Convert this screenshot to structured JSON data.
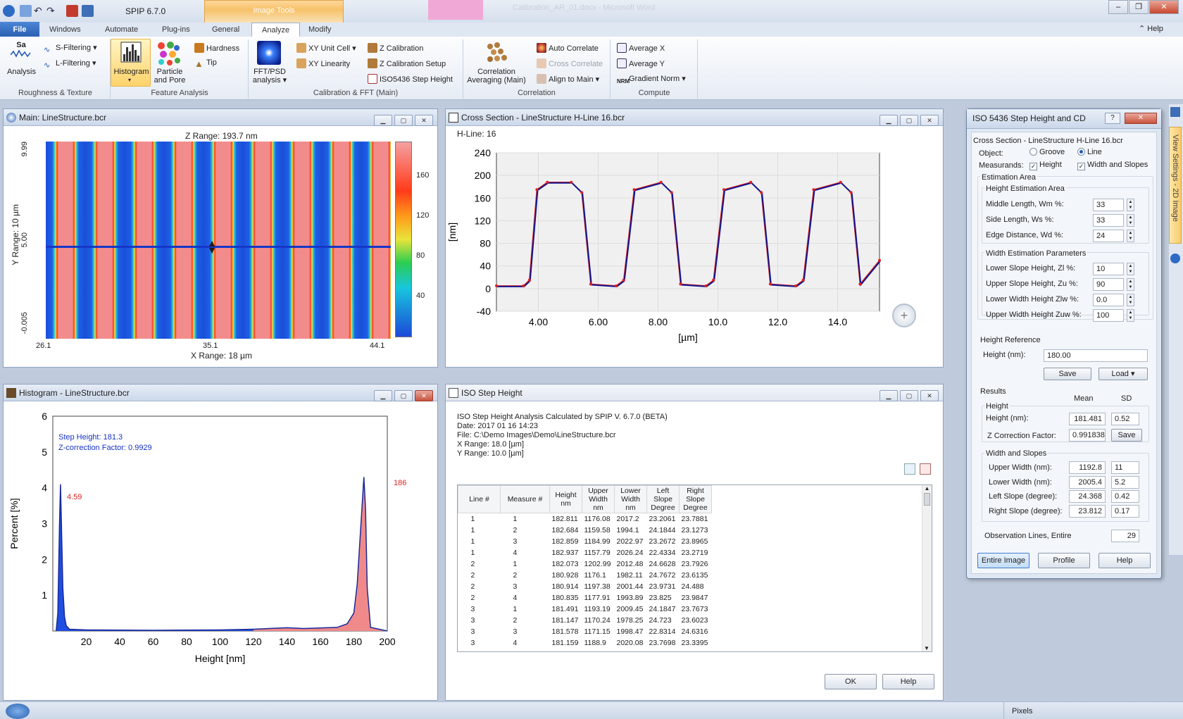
{
  "app": {
    "title": "SPIP 6.7.0",
    "contextual_tab": "Image Tools",
    "window_title": "Calibration_AR_01.docx - Microsoft Word",
    "help_label": "Help"
  },
  "tabs": [
    "File",
    "Windows",
    "Automate",
    "Plug-ins",
    "General",
    "Analyze",
    "Modify"
  ],
  "ribbon": {
    "roughness": {
      "analysis": "Analysis",
      "s_filtering": "S-Filtering",
      "l_filtering": "L-Filtering",
      "group": "Roughness & Texture"
    },
    "feature": {
      "histogram": "Histogram",
      "particle": "Particle",
      "and_pore": "and Pore",
      "hardness": "Hardness",
      "tip": "Tip",
      "group": "Feature Analysis"
    },
    "calib": {
      "fft_psd": "FFT/PSD",
      "analysis": "analysis",
      "xy_unit_cell": "XY Unit Cell",
      "xy_linearity": "XY Linearity",
      "z_calibration": "Z Calibration",
      "z_calibration_setup": "Z Calibration Setup",
      "iso5436": "ISO5436 Step Height",
      "group": "Calibration & FFT (Main)"
    },
    "correlation": {
      "corr_avg_1": "Correlation",
      "corr_avg_2": "Averaging (Main)",
      "auto_correlate": "Auto Correlate",
      "cross_correlate": "Cross Correlate",
      "align_to_main": "Align to Main",
      "group": "Correlation"
    },
    "compute": {
      "average_x": "Average X",
      "average_y": "Average Y",
      "gradient_norm": "Gradient Norm",
      "group": "Compute"
    }
  },
  "main_panel": {
    "title": "Main: LineStructure.bcr",
    "z_range": "Z Range:  193.7 nm",
    "y_range": "Y Range: 10 µm",
    "x_range": "X Range: 18 µm",
    "x_ticks": [
      "26.1",
      "35.1",
      "44.1"
    ],
    "y_ticks": [
      "9.99",
      "5.00",
      "-0.005"
    ],
    "colorbar_ticks": [
      "160",
      "120",
      "80",
      "40"
    ]
  },
  "cross_panel": {
    "title": "Cross Section - LineStructure H-Line 16.bcr",
    "h_line": "H-Line: 16"
  },
  "hist_panel": {
    "title": "Histogram - LineStructure.bcr",
    "step_height": "Step Height:  181.3",
    "z_corr": "Z-correction Factor: 0.9929",
    "peak1": "4.59",
    "peak2": "186"
  },
  "iso_panel": {
    "title": "ISO Step Height",
    "header_lines": [
      "ISO Step Height Analysis Calculated by SPIP V. 6.7.0 (BETA)",
      "Date: 2017 01 16 14:23",
      "File: C:\\Demo Images\\Demo\\LineStructure.bcr",
      "X Range: 18.0 [µm]",
      "Y Range: 10.0 [µm]"
    ],
    "columns": [
      "Line #",
      "Measure #",
      "Height nm",
      "Upper Width nm",
      "Lower Width nm",
      "Left Slope Degree",
      "Right Slope Degree"
    ],
    "rows": [
      [
        "1",
        "1",
        "182.811",
        "1176.08",
        "2017.2",
        "23.2061",
        "23.7881"
      ],
      [
        "1",
        "2",
        "182.684",
        "1159.58",
        "1994.1",
        "24.1844",
        "23.1273"
      ],
      [
        "1",
        "3",
        "182.859",
        "1184.99",
        "2022.97",
        "23.2672",
        "23.8965"
      ],
      [
        "1",
        "4",
        "182.937",
        "1157.79",
        "2026.24",
        "22.4334",
        "23.2719"
      ],
      [
        "2",
        "1",
        "182.073",
        "1202.99",
        "2012.48",
        "24.6628",
        "23.7926"
      ],
      [
        "2",
        "2",
        "180.928",
        "1176.1",
        "1982.11",
        "24.7672",
        "23.6135"
      ],
      [
        "2",
        "3",
        "180.914",
        "1197.38",
        "2001.44",
        "23.9731",
        "24.488"
      ],
      [
        "2",
        "4",
        "180.835",
        "1177.91",
        "1993.89",
        "23.825",
        "23.9847"
      ],
      [
        "3",
        "1",
        "181.491",
        "1193.19",
        "2009.45",
        "24.1847",
        "23.7673"
      ],
      [
        "3",
        "2",
        "181.147",
        "1170.24",
        "1978.25",
        "24.723",
        "23.6023"
      ],
      [
        "3",
        "3",
        "181.578",
        "1171.15",
        "1998.47",
        "22.8314",
        "24.6316"
      ],
      [
        "3",
        "4",
        "181.159",
        "1188.9",
        "2020.08",
        "23.7698",
        "23.3395"
      ]
    ],
    "ok": "OK",
    "help": "Help"
  },
  "dialog": {
    "title": "ISO 5436 Step Height and CD",
    "subtitle": "Cross Section - LineStructure H-Line 16.bcr",
    "object_label": "Object:",
    "groove": "Groove",
    "line": "Line",
    "measurands": "Measurands:",
    "height": "Height",
    "width_slopes": "Width and Slopes",
    "estimation_area": "Estimation Area",
    "height_est": "Height Estimation Area",
    "middle_length": "Middle Length, Wm %:",
    "middle_val": "33",
    "side_length": "Side Length, Ws %:",
    "side_val": "33",
    "edge_distance": "Edge Distance, Wd %:",
    "edge_val": "24",
    "width_est": "Width Estimation Parameters",
    "lower_slope": "Lower Slope Height, Zl %:",
    "lower_val": "10",
    "upper_slope": "Upper Slope Height, Zu %:",
    "upper_val": "90",
    "lower_width": "Lower Width Height Zlw %:",
    "lower_width_val": "0.0",
    "upper_width": "Upper Width Height Zuw %:",
    "upper_width_val": "100",
    "height_ref": "Height Reference",
    "height_nm": "Height (nm):",
    "height_ref_val": "180.00",
    "save": "Save",
    "load": "Load",
    "results": "Results",
    "mean": "Mean",
    "sd": "SD",
    "height_group": "Height",
    "res_height": "Height (nm):",
    "res_height_mean": "181.481",
    "res_height_sd": "0.52",
    "z_corr": "Z Correction Factor:",
    "z_corr_val": "0.991838",
    "save2": "Save",
    "width_group": "Width and Slopes",
    "upper_width_res": "Upper Width (nm):",
    "uw_mean": "1192.8",
    "uw_sd": "11",
    "lower_width_res": "Lower Width (nm):",
    "lw_mean": "2005.4",
    "lw_sd": "5.2",
    "left_slope": "Left Slope (degree):",
    "ls_mean": "24.368",
    "ls_sd": "0.42",
    "right_slope": "Right Slope (degree):",
    "rs_mean": "23.812",
    "rs_sd": "0.17",
    "obs_lines": "Observation Lines, Entire",
    "obs_val": "29",
    "entire_image": "Entire Image",
    "profile": "Profile",
    "help": "Help"
  },
  "side_tab": "View Settings - 2D Image",
  "status": {
    "pixels": "Pixels"
  },
  "chart_data": [
    {
      "type": "line",
      "title": "",
      "xlabel": "[µm]",
      "ylabel": "[nm]",
      "xlim": [
        2.6,
        15.4
      ],
      "ylim": [
        -40,
        240
      ],
      "x_ticks": [
        "4.00",
        "6.00",
        "8.00",
        "10.0",
        "12.0",
        "14.0"
      ],
      "y_ticks": [
        "240",
        "200",
        "160",
        "120",
        "80",
        "40",
        "0",
        "-40"
      ],
      "series": [
        {
          "name": "",
          "x": [
            2.6,
            3.5,
            3.7,
            3.95,
            4.3,
            5.1,
            5.45,
            5.75,
            6.6,
            6.85,
            7.2,
            8.1,
            8.45,
            8.75,
            9.6,
            9.85,
            10.2,
            11.1,
            11.45,
            11.75,
            12.6,
            12.85,
            13.2,
            14.1,
            14.45,
            14.75,
            15.4
          ],
          "y": [
            5,
            5,
            15,
            175,
            188,
            188,
            170,
            8,
            5,
            15,
            175,
            188,
            170,
            8,
            5,
            15,
            175,
            188,
            170,
            8,
            5,
            15,
            175,
            188,
            170,
            8,
            50
          ]
        }
      ]
    },
    {
      "type": "area",
      "title": "",
      "xlabel": "Height [nm]",
      "ylabel": "Percent [%]",
      "xlim": [
        0,
        200
      ],
      "ylim": [
        0,
        6
      ],
      "x_ticks": [
        "20",
        "40",
        "60",
        "80",
        "100",
        "120",
        "140",
        "160",
        "180",
        "200"
      ],
      "y_ticks": [
        "6",
        "5",
        "4",
        "3",
        "2",
        "1"
      ],
      "x": [
        2,
        3,
        4,
        4.59,
        5,
        6,
        7,
        8,
        10,
        20,
        60,
        100,
        120,
        140,
        150,
        170,
        176,
        180,
        182,
        184,
        186,
        187,
        188,
        190,
        200
      ],
      "values": [
        0,
        0.5,
        3.0,
        4.1,
        3.3,
        1.2,
        0.4,
        0.15,
        0.05,
        0.03,
        0.02,
        0.03,
        0.05,
        0.09,
        0.07,
        0.1,
        0.2,
        0.5,
        1.3,
        2.8,
        4.3,
        3.4,
        1.2,
        0.1,
        0
      ]
    }
  ]
}
